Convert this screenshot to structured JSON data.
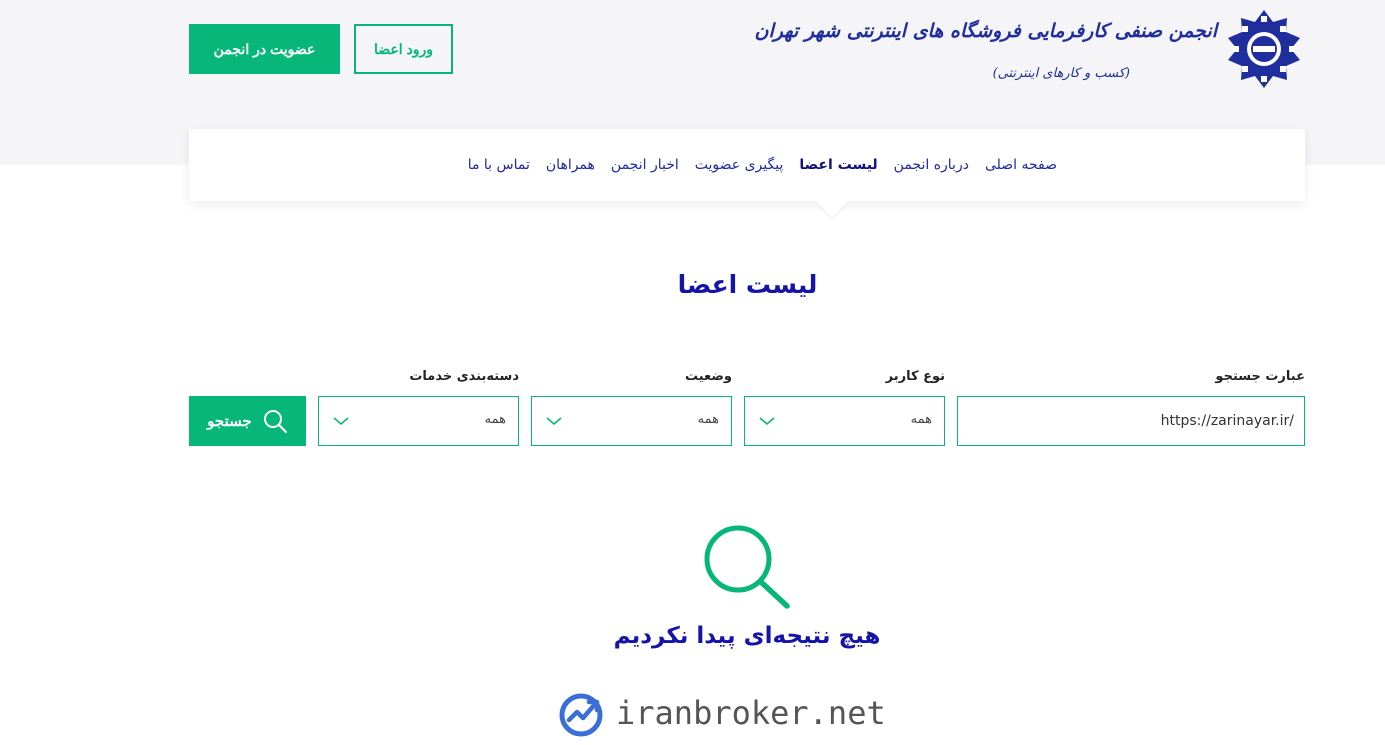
{
  "header": {
    "logo_title": "انجمن صنفی کارفرمایی فروشگاه های اینترنتی شهر تهران",
    "logo_subtitle": "(کسب و کارهای اینترنتی)",
    "join_label": "عضویت در انجمن",
    "login_label": "ورود اعضا"
  },
  "nav": {
    "items": [
      {
        "label": "صفحه اصلی"
      },
      {
        "label": "درباره انجمن"
      },
      {
        "label": "لیست اعضا",
        "active": true
      },
      {
        "label": "پیگیری عضویت"
      },
      {
        "label": "اخبار انجمن"
      },
      {
        "label": "همراهان"
      },
      {
        "label": "تماس با ما"
      }
    ]
  },
  "page": {
    "title": "لیست اعضا"
  },
  "filters": {
    "search_label": "عبارت جستجو",
    "search_value": "https://zarinayar.ir/",
    "user_type_label": "نوع کاربر",
    "user_type_value": "همه",
    "status_label": "وضعیت",
    "status_value": "همه",
    "category_label": "دسته‌بندی خدمات",
    "category_value": "همه",
    "search_button": "جستجو"
  },
  "results": {
    "empty_message": "هیچ نتیجه‌ای پیدا نکردیم"
  },
  "watermark": {
    "text": "iranbroker.net"
  },
  "colors": {
    "accent": "#07b679",
    "primary_text": "#1414a8",
    "band": "#f5f5f8"
  }
}
